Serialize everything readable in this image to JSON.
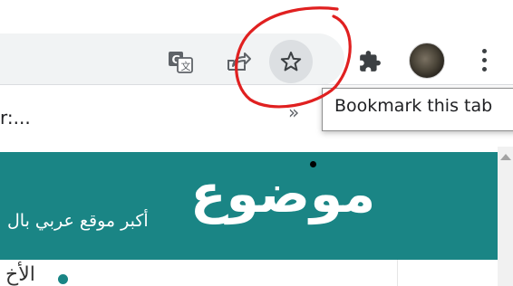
{
  "toolbar": {
    "icons": [
      "translate-icon",
      "share-icon",
      "bookmark-star-icon",
      "extensions-icon",
      "profile-avatar",
      "more-menu-icon"
    ]
  },
  "bookmarks_bar": {
    "truncated_item": "r:...",
    "more_label": "»"
  },
  "tooltip": {
    "text": "Bookmark this tab"
  },
  "page": {
    "logo_text": "موضوع",
    "tagline": "أكبر موقع عربي بال",
    "list_item_partial": "الأخ",
    "brand_color": "#1a8585"
  },
  "colors": {
    "star_hover_bg": "#dcdfe2",
    "annotation_circle": "#e02020"
  }
}
